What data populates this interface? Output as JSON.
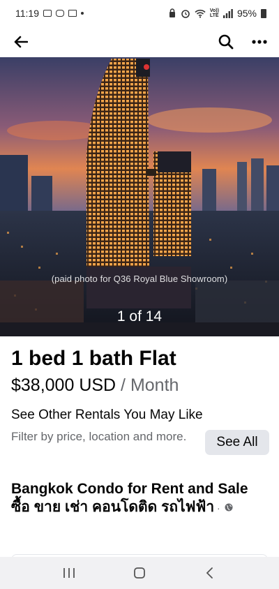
{
  "status_bar": {
    "time": "11:19",
    "volte": "Vo))\nLTE",
    "battery": "95%"
  },
  "listing": {
    "photo_caption": "(paid photo for Q36 Royal Blue Showroom)",
    "photo_counter": "1 of 14",
    "title": "1 bed 1 bath Flat",
    "price": "$38,000 USD",
    "period": " / Month"
  },
  "rentals": {
    "title": "See Other Rentals You May Like",
    "subtitle": "Filter by price, location and more.",
    "see_all_label": "See All"
  },
  "group": {
    "name": "Bangkok Condo for Rent and Sale ซื้อ ขาย เช่า คอนโดติด รถไฟฟ้า",
    "separator": " · "
  },
  "icons": {
    "back": "arrow-left",
    "search": "magnifier",
    "more": "three-dots",
    "globe": "globe"
  },
  "colors": {
    "secondary_text": "#65676b",
    "button_bg": "#e4e6eb"
  }
}
